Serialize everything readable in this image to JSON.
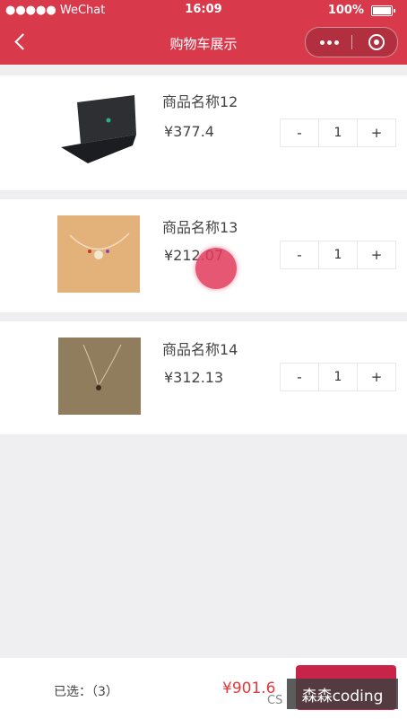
{
  "status_bar": {
    "carrier": "●●●●● WeChat",
    "time": "16:09",
    "battery": "100%"
  },
  "nav": {
    "title": "购物车展示"
  },
  "cart": {
    "items": [
      {
        "name": "商品名称12",
        "price": "¥377.4",
        "quantity": "1",
        "minus": "-",
        "plus": "+"
      },
      {
        "name": "商品名称13",
        "price": "¥212.07",
        "quantity": "1",
        "minus": "-",
        "plus": "+"
      },
      {
        "name": "商品名称14",
        "price": "¥312.13",
        "quantity": "1",
        "minus": "-",
        "plus": "+"
      }
    ]
  },
  "footer": {
    "selected": "已选：（3）",
    "total": "¥901.6"
  },
  "watermark": {
    "text": "森森coding",
    "prefix": "CS"
  }
}
